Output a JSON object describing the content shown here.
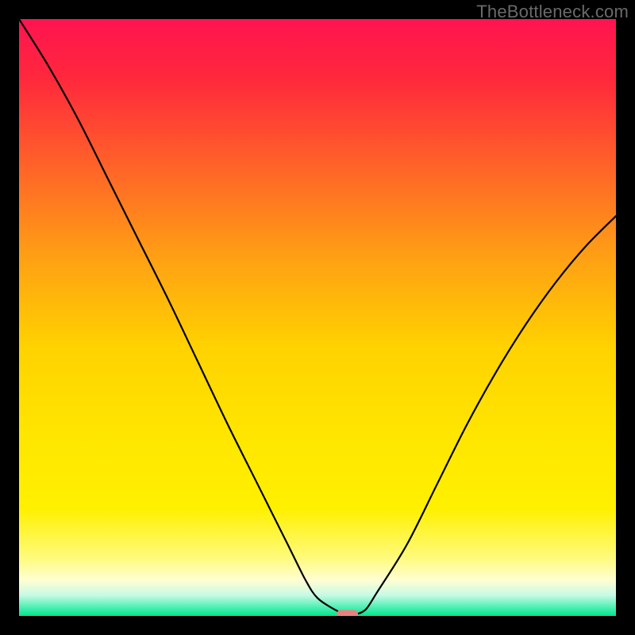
{
  "watermark": "TheBottleneck.com",
  "chart_data": {
    "type": "line",
    "title": "",
    "xlabel": "",
    "ylabel": "",
    "xlim": [
      0,
      100
    ],
    "ylim": [
      0,
      100
    ],
    "legend": false,
    "grid": false,
    "background_gradient": {
      "type": "vertical-spectral",
      "stops": [
        {
          "pos": 0.0,
          "color": "#ff1450"
        },
        {
          "pos": 0.1,
          "color": "#ff283c"
        },
        {
          "pos": 0.25,
          "color": "#ff6428"
        },
        {
          "pos": 0.4,
          "color": "#ffa014"
        },
        {
          "pos": 0.55,
          "color": "#ffd200"
        },
        {
          "pos": 0.7,
          "color": "#ffe600"
        },
        {
          "pos": 0.82,
          "color": "#fff000"
        },
        {
          "pos": 0.9,
          "color": "#fffa78"
        },
        {
          "pos": 0.94,
          "color": "#fffed2"
        },
        {
          "pos": 0.965,
          "color": "#c8fae6"
        },
        {
          "pos": 0.985,
          "color": "#50f0b4"
        },
        {
          "pos": 1.0,
          "color": "#00e68c"
        }
      ]
    },
    "series": [
      {
        "name": "bottleneck-curve",
        "color": "#000000",
        "width": 2.2,
        "x": [
          0,
          5,
          10,
          15,
          20,
          25,
          30,
          35,
          40,
          45,
          48,
          50,
          53,
          55,
          56,
          58,
          60,
          65,
          70,
          75,
          80,
          85,
          90,
          95,
          100
        ],
        "values": [
          100,
          92,
          83,
          73,
          63,
          53,
          42.5,
          32,
          22,
          12,
          6,
          3,
          1,
          0.2,
          0.2,
          1,
          4,
          12,
          22,
          32,
          41,
          49,
          56,
          62,
          67
        ]
      }
    ],
    "marker": {
      "name": "optimal-point",
      "shape": "rounded-rect",
      "color": "#e8817e",
      "x": 55,
      "y": 0.2,
      "width_pct": 3.6,
      "height_pct": 1.6
    }
  }
}
